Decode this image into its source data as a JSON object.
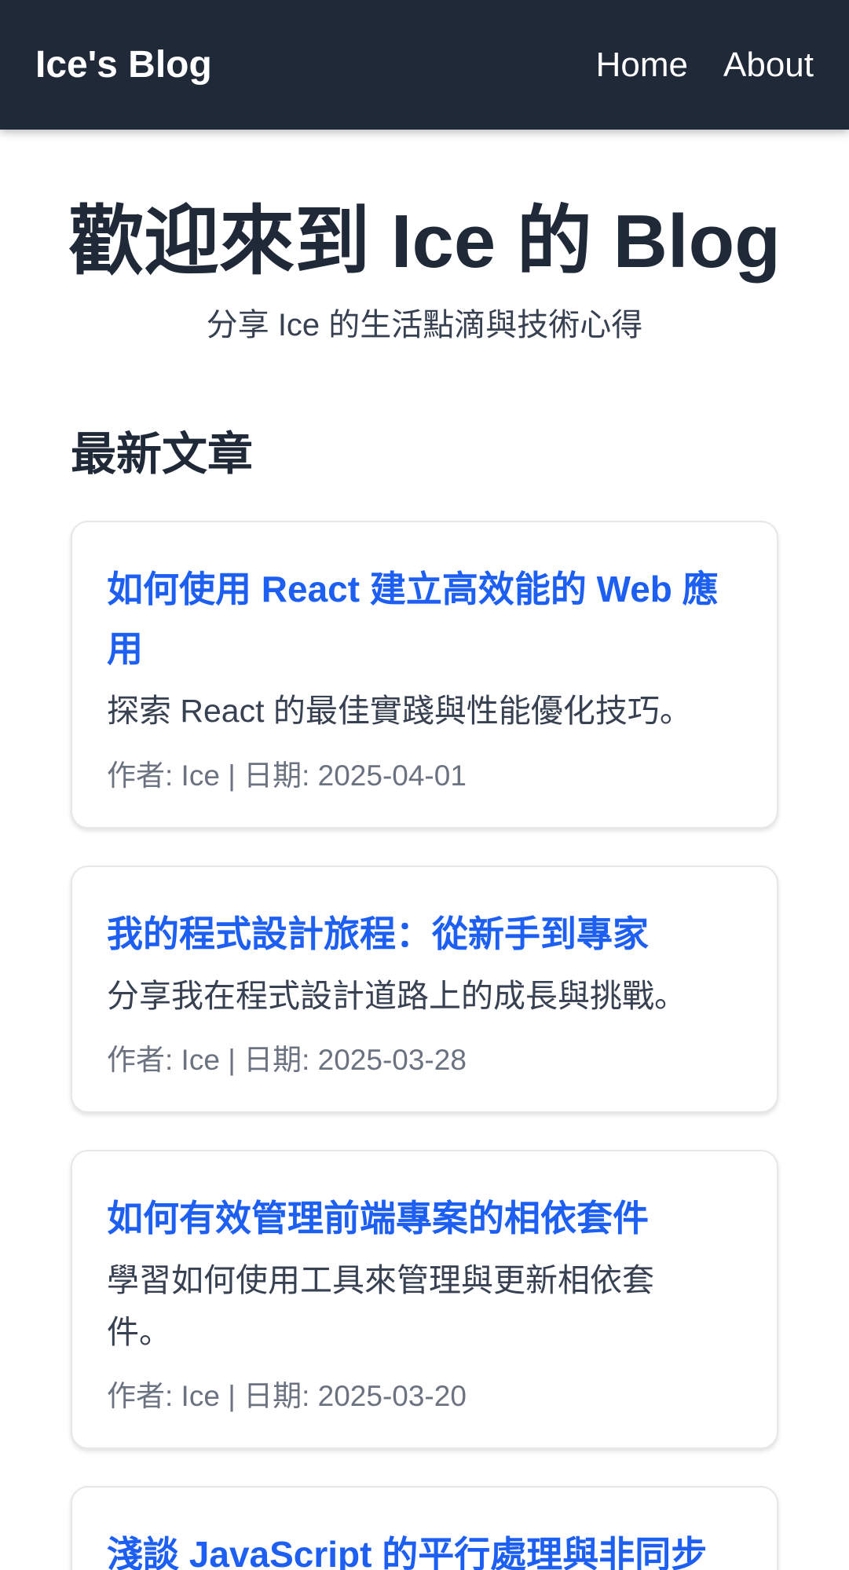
{
  "header": {
    "brand": "Ice's Blog",
    "nav": [
      {
        "label": "Home"
      },
      {
        "label": "About"
      }
    ]
  },
  "hero": {
    "title": "歡迎來到 Ice 的 Blog",
    "subtitle": "分享 Ice 的生活點滴與技術心得"
  },
  "section": {
    "title": "最新文章"
  },
  "posts": [
    {
      "title": "如何使用 React 建立高效能的 Web 應用",
      "excerpt": "探索 React 的最佳實踐與性能優化技巧。",
      "meta": "作者: Ice | 日期: 2025-04-01"
    },
    {
      "title": "我的程式設計旅程：從新手到專家",
      "excerpt": "分享我在程式設計道路上的成長與挑戰。",
      "meta": "作者: Ice | 日期: 2025-03-28"
    },
    {
      "title": "如何有效管理前端專案的相依套件",
      "excerpt": "學習如何使用工具來管理與更新相依套件。",
      "meta": "作者: Ice | 日期: 2025-03-20"
    },
    {
      "title": "淺談 JavaScript 的平行處理與非同步"
    }
  ]
}
